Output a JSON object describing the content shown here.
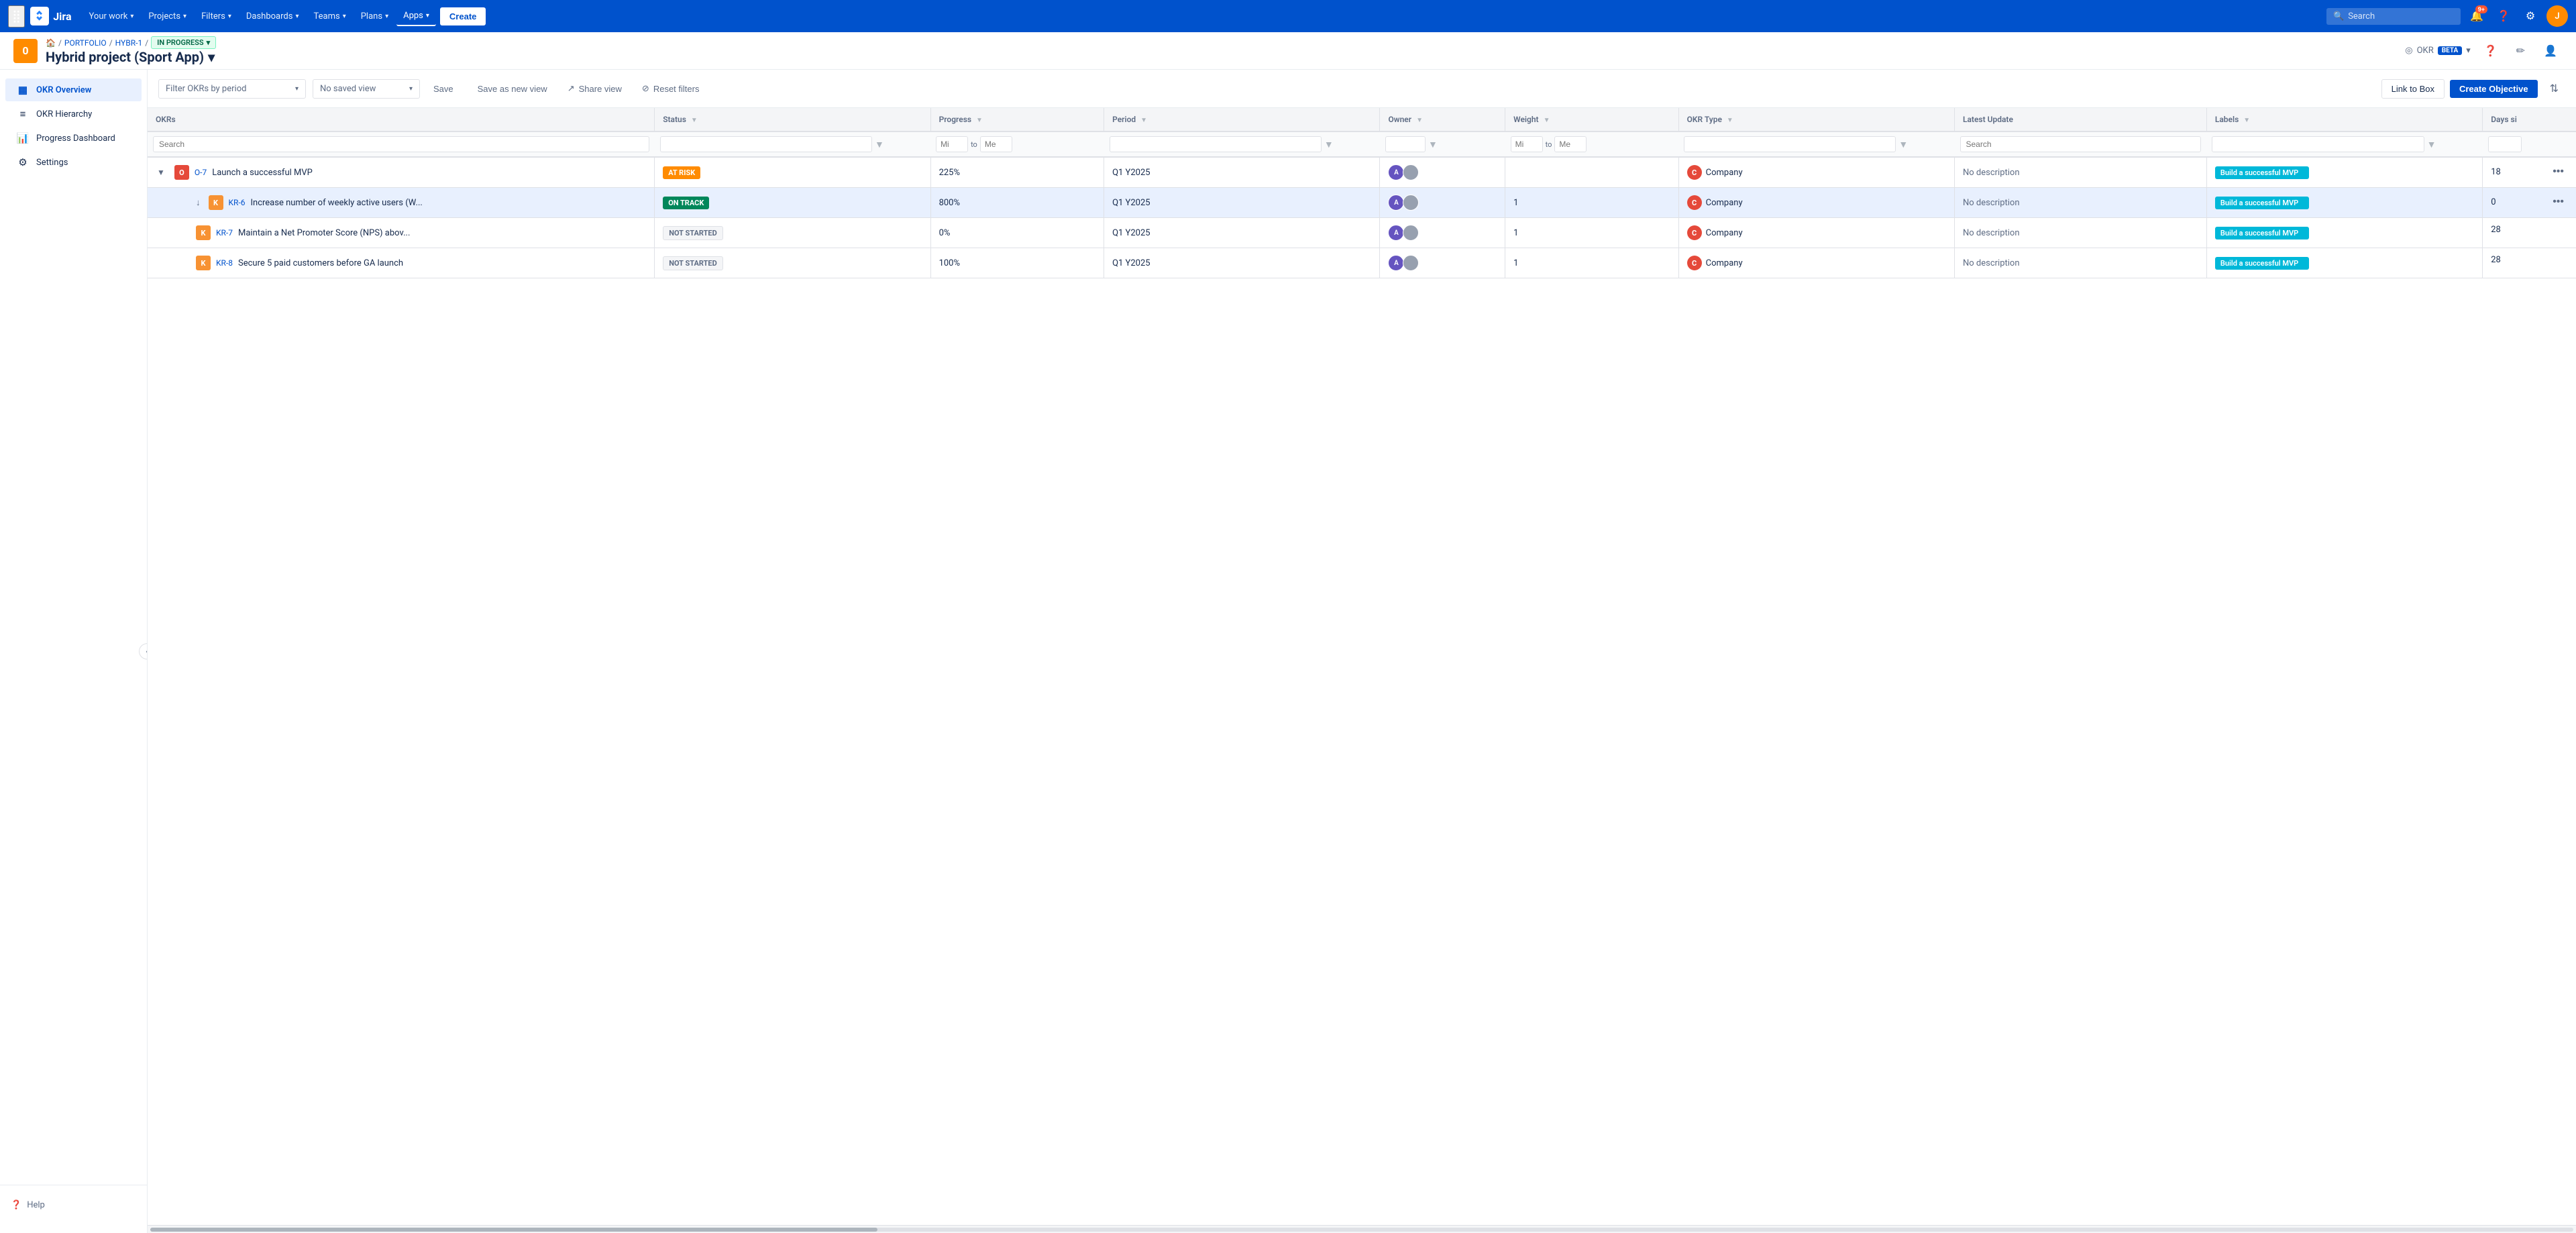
{
  "topnav": {
    "logo_text": "Jira",
    "menu_items": [
      {
        "label": "Your work",
        "has_dropdown": true
      },
      {
        "label": "Projects",
        "has_dropdown": true
      },
      {
        "label": "Filters",
        "has_dropdown": true
      },
      {
        "label": "Dashboards",
        "has_dropdown": true
      },
      {
        "label": "Teams",
        "has_dropdown": true
      },
      {
        "label": "Plans",
        "has_dropdown": true
      },
      {
        "label": "Apps",
        "has_dropdown": true,
        "active": true
      }
    ],
    "create_label": "Create",
    "search_placeholder": "Search",
    "notifications_count": "9+",
    "user_initial": "J"
  },
  "project_header": {
    "breadcrumb": {
      "home": "🏠",
      "portfolio": "PORTFOLIO",
      "project_id": "HYBR-1",
      "status": "IN PROGRESS"
    },
    "title": "Hybrid project (Sport App)",
    "avatar_initial": "0",
    "okr_label": "OKR",
    "beta_label": "BETA"
  },
  "sidebar": {
    "items": [
      {
        "label": "OKR Overview",
        "icon": "▦",
        "active": true
      },
      {
        "label": "OKR Hierarchy",
        "icon": "≡"
      },
      {
        "label": "Progress Dashboard",
        "icon": "📊"
      },
      {
        "label": "Settings",
        "icon": "⚙"
      }
    ],
    "help_label": "Help"
  },
  "toolbar": {
    "filter_placeholder": "Filter OKRs by period",
    "saved_view_placeholder": "No saved view",
    "save_label": "Save",
    "save_as_new_view_label": "Save as new view",
    "share_view_label": "Share view",
    "reset_filters_label": "Reset filters",
    "link_to_box_label": "Link to Box",
    "create_objective_label": "Create Objective"
  },
  "table": {
    "columns": [
      {
        "label": "OKRs",
        "has_filter": false
      },
      {
        "label": "Status",
        "has_filter": true
      },
      {
        "label": "Progress",
        "has_filter": true
      },
      {
        "label": "Period",
        "has_filter": true
      },
      {
        "label": "Owner",
        "has_filter": true
      },
      {
        "label": "Weight",
        "has_filter": true
      },
      {
        "label": "OKR Type",
        "has_filter": true
      },
      {
        "label": "Latest Update",
        "has_filter": false
      },
      {
        "label": "Labels",
        "has_filter": true
      },
      {
        "label": "Days si",
        "has_filter": false
      }
    ],
    "filter_row": {
      "search_placeholder": "Search",
      "progress_min": "Mi",
      "progress_max": "Me",
      "weight_min": "Mi",
      "weight_max": "Me",
      "latest_update_placeholder": "Search"
    },
    "rows": [
      {
        "id": "O-7",
        "type": "O",
        "type_color": "#e5493a",
        "indent": 0,
        "expandable": true,
        "expanded": true,
        "title": "Launch a successful MVP",
        "status": "AT RISK",
        "status_class": "status-at-risk",
        "progress": "225%",
        "period": "Q1 Y2025",
        "weight": "",
        "okr_type": "Company",
        "okr_type_color": "#e5493a",
        "latest_update": "No description",
        "label": "Build a successful MVP",
        "days": "18",
        "has_more": true,
        "selected": false
      },
      {
        "id": "KR-6",
        "type": "KR",
        "type_color": "#f79233",
        "indent": 1,
        "expandable": false,
        "expanded": false,
        "title": "Increase number of weekly active users (W...",
        "status": "ON TRACK",
        "status_class": "status-on-track",
        "progress": "800%",
        "period": "Q1 Y2025",
        "weight": "1",
        "okr_type": "Company",
        "okr_type_color": "#e5493a",
        "latest_update": "No description",
        "label": "Build a successful MVP",
        "days": "0",
        "has_more": true,
        "selected": true
      },
      {
        "id": "KR-7",
        "type": "KR",
        "type_color": "#f79233",
        "indent": 1,
        "expandable": false,
        "expanded": false,
        "title": "Maintain a Net Promoter Score (NPS) abov...",
        "status": "NOT STARTED",
        "status_class": "status-not-started",
        "progress": "0%",
        "period": "Q1 Y2025",
        "weight": "1",
        "okr_type": "Company",
        "okr_type_color": "#e5493a",
        "latest_update": "No description",
        "label": "Build a successful MVP",
        "days": "28",
        "has_more": false,
        "selected": false
      },
      {
        "id": "KR-8",
        "type": "KR",
        "type_color": "#f79233",
        "indent": 1,
        "expandable": false,
        "expanded": false,
        "title": "Secure 5 paid customers before GA launch",
        "status": "NOT STARTED",
        "status_class": "status-not-started",
        "progress": "100%",
        "period": "Q1 Y2025",
        "weight": "1",
        "okr_type": "Company",
        "okr_type_color": "#e5493a",
        "latest_update": "No description",
        "label": "Build a successful MVP",
        "days": "28",
        "has_more": false,
        "selected": false
      }
    ]
  }
}
